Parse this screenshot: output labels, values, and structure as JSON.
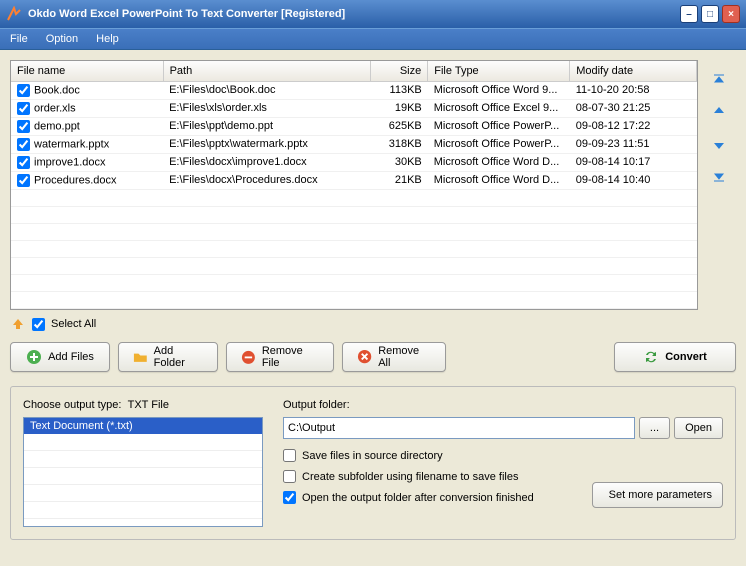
{
  "window": {
    "title": "Okdo Word Excel PowerPoint To Text Converter [Registered]"
  },
  "menu": {
    "file": "File",
    "option": "Option",
    "help": "Help"
  },
  "table": {
    "headers": {
      "name": "File name",
      "path": "Path",
      "size": "Size",
      "type": "File Type",
      "date": "Modify date"
    },
    "rows": [
      {
        "name": "Book.doc",
        "path": "E:\\Files\\doc\\Book.doc",
        "size": "113KB",
        "type": "Microsoft Office Word 9...",
        "date": "11-10-20 20:58"
      },
      {
        "name": "order.xls",
        "path": "E:\\Files\\xls\\order.xls",
        "size": "19KB",
        "type": "Microsoft Office Excel 9...",
        "date": "08-07-30 21:25"
      },
      {
        "name": "demo.ppt",
        "path": "E:\\Files\\ppt\\demo.ppt",
        "size": "625KB",
        "type": "Microsoft Office PowerP...",
        "date": "09-08-12 17:22"
      },
      {
        "name": "watermark.pptx",
        "path": "E:\\Files\\pptx\\watermark.pptx",
        "size": "318KB",
        "type": "Microsoft Office PowerP...",
        "date": "09-09-23 11:51"
      },
      {
        "name": "improve1.docx",
        "path": "E:\\Files\\docx\\improve1.docx",
        "size": "30KB",
        "type": "Microsoft Office Word D...",
        "date": "09-08-14 10:17"
      },
      {
        "name": "Procedures.docx",
        "path": "E:\\Files\\docx\\Procedures.docx",
        "size": "21KB",
        "type": "Microsoft Office Word D...",
        "date": "09-08-14 10:40"
      }
    ]
  },
  "selectall": "Select All",
  "buttons": {
    "addfiles": "Add Files",
    "addfolder": "Add Folder",
    "removefile": "Remove File",
    "removeall": "Remove All",
    "convert": "Convert"
  },
  "output": {
    "choose_label": "Choose output type:",
    "type_label": "TXT File",
    "type_option": "Text Document (*.txt)",
    "folder_label": "Output folder:",
    "folder_value": "C:\\Output",
    "browse": "...",
    "open": "Open",
    "chk_source": "Save files in source directory",
    "chk_subfolder": "Create subfolder using filename to save files",
    "chk_openafter": "Open the output folder after conversion finished",
    "more": "Set more parameters"
  }
}
